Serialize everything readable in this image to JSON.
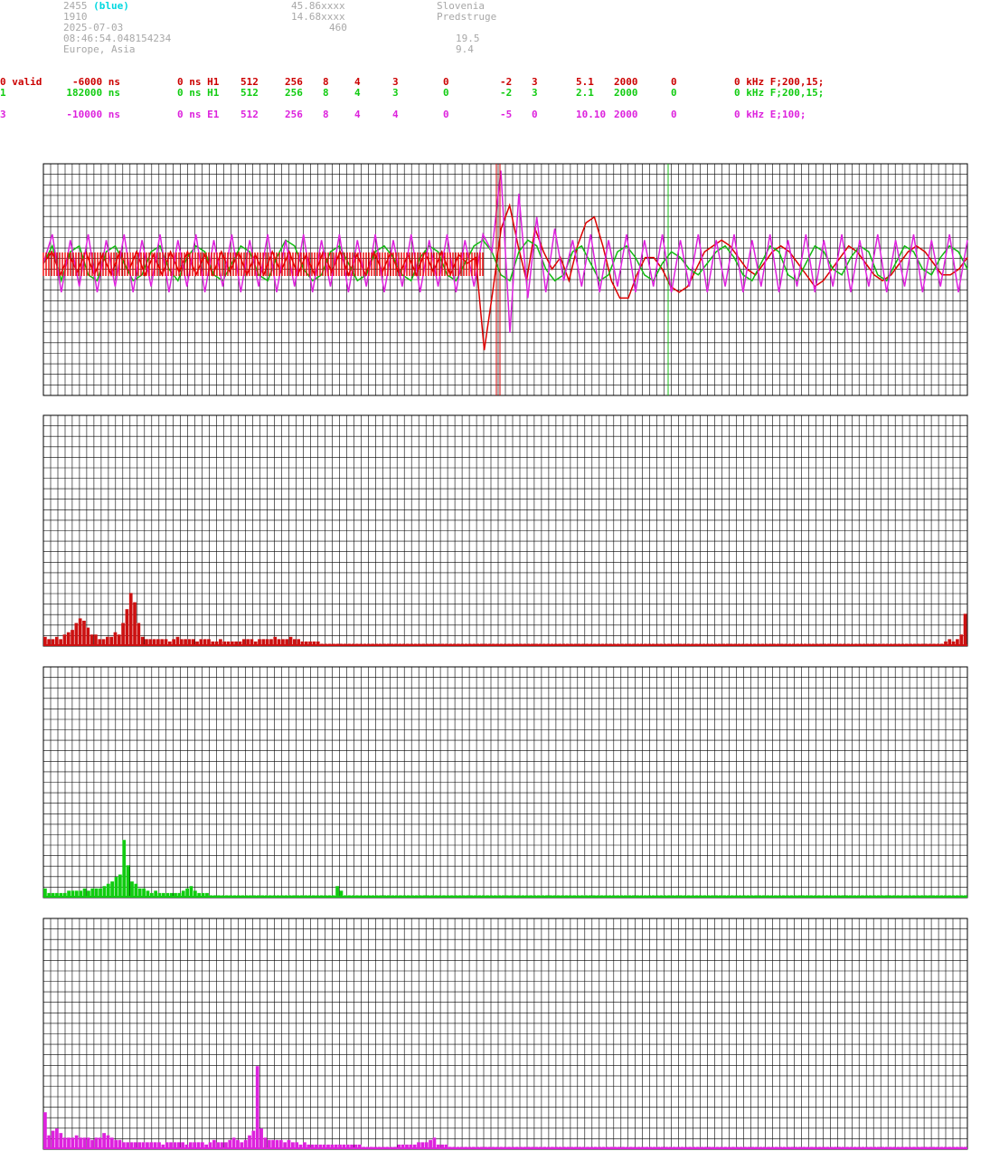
{
  "header": {
    "station_id": "2455",
    "station_tag": "(blue)",
    "line2": "1910",
    "date": "2025-07-03",
    "time": "08:46:54.048154234",
    "region": "Europe, Asia",
    "lat": "45.86xxxx",
    "lon": "14.68xxxx",
    "alt": "460",
    "country": "Slovenia",
    "place": "Predstruge",
    "v1": "19.5",
    "v2": "9.4"
  },
  "channels": [
    {
      "c1": "0 valid",
      "c2": "-6000 ns",
      "c3": "0 ns H1",
      "c4": "512",
      "c5": "256",
      "c6": "8",
      "c7": "4",
      "c8": "3",
      "c9": "0",
      "c10": "-2",
      "c11": "3",
      "c12": "5.1",
      "c13": "2000",
      "c14": "0",
      "c15": "0 kHz F;200,15;"
    },
    {
      "c1": "1",
      "c2": "182000 ns",
      "c3": "0 ns H1",
      "c4": "512",
      "c5": "256",
      "c6": "8",
      "c7": "4",
      "c8": "3",
      "c9": "0",
      "c10": "-2",
      "c11": "3",
      "c12": "2.1",
      "c13": "2000",
      "c14": "0",
      "c15": "0 kHz F;200,15;"
    },
    {
      "c1": "3",
      "c2": "-10000 ns",
      "c3": "0 ns E1",
      "c4": "512",
      "c5": "256",
      "c6": "8",
      "c7": "4",
      "c8": "4",
      "c9": "0",
      "c10": "-5",
      "c11": "0",
      "c12": "10.10",
      "c13": "2000",
      "c14": "0",
      "c15": "0 kHz E;100;"
    }
  ],
  "colors": {
    "red": "#cc0000",
    "green": "#11cc11",
    "magenta": "#dd22dd",
    "grid": "#000000"
  },
  "chart_data": [
    {
      "type": "line",
      "series": [
        {
          "color": "#dd0000",
          "values": [
            0,
            0.2,
            -0.2,
            0.15,
            -0.15,
            0.2,
            -0.2,
            0.15,
            -0.2,
            0.2,
            -0.15,
            0.2,
            -0.2,
            0.15,
            -0.2,
            0.2,
            -0.15,
            0.2,
            -0.2,
            0.15,
            -0.2,
            0.2,
            -0.15,
            0.2,
            -0.2,
            0.15,
            -0.2,
            0.2,
            -0.15,
            0.2,
            -0.2,
            0.15,
            -0.2,
            0.2,
            -0.15,
            0.2,
            -0.2,
            0.15,
            -0.2,
            0.2,
            -0.15,
            0.2,
            -0.2,
            0.15,
            -0.2,
            0.2,
            -0.15,
            0.2,
            -0.2,
            0.15,
            0,
            0.1,
            -1.5,
            -0.5,
            0.6,
            1.0,
            0.3,
            -0.3,
            0.6,
            0.2,
            -0.1,
            0.1,
            -0.3,
            0.3,
            0.7,
            0.8,
            0.3,
            -0.3,
            -0.6,
            -0.6,
            -0.2,
            0.1,
            0.1,
            -0.1,
            -0.4,
            -0.5,
            -0.4,
            -0.1,
            0.2,
            0.3,
            0.4,
            0.3,
            0.1,
            -0.1,
            -0.2,
            0,
            0.2,
            0.3,
            0.2,
            0,
            -0.2,
            -0.4,
            -0.3,
            -0.1,
            0.1,
            0.3,
            0.2,
            0,
            -0.2,
            -0.3,
            -0.2,
            0,
            0.2,
            0.3,
            0.2,
            0,
            -0.2,
            -0.2,
            -0.1,
            0.1
          ]
        },
        {
          "color": "#11bb11",
          "values": [
            0,
            0.3,
            -0.3,
            0.2,
            0.3,
            -0.2,
            -0.3,
            0.2,
            0.3,
            0,
            -0.3,
            -0.2,
            0.2,
            0.3,
            -0.1,
            -0.3,
            0.1,
            0.3,
            0.2,
            -0.2,
            -0.3,
            0,
            0.3,
            0.2,
            -0.2,
            -0.3,
            0.1,
            0.4,
            0.3,
            -0.1,
            -0.3,
            -0.2,
            0.2,
            0.3,
            0,
            -0.3,
            -0.2,
            0.2,
            0.3,
            0.1,
            -0.2,
            -0.3,
            0.1,
            0.3,
            0.2,
            -0.2,
            -0.3,
            0,
            0.3,
            0.4,
            0.2,
            -0.2,
            -0.3,
            0.2,
            0.4,
            0.3,
            -0.1,
            -0.3,
            -0.2,
            0.2,
            0.3,
            0,
            -0.3,
            -0.2,
            0.2,
            0.3,
            0.1,
            -0.2,
            -0.3,
            0,
            0.2,
            0.1,
            -0.1,
            -0.2,
            0,
            0.2,
            0.3,
            0.1,
            -0.2,
            -0.3,
            0,
            0.3,
            0.2,
            -0.2,
            -0.3,
            0,
            0.3,
            0.2,
            -0.1,
            -0.2,
            0.1,
            0.3,
            0.2,
            -0.2,
            -0.3,
            0,
            0.3,
            0.2,
            -0.1,
            -0.2,
            0.1,
            0.3,
            0.2,
            -0.1
          ]
        },
        {
          "color": "#dd22dd",
          "values": [
            0,
            0.5,
            -0.5,
            0.4,
            -0.4,
            0.5,
            -0.5,
            0.4,
            -0.4,
            0.5,
            -0.5,
            0.4,
            -0.4,
            0.5,
            -0.5,
            0.4,
            -0.4,
            0.5,
            -0.5,
            0.4,
            -0.4,
            0.5,
            -0.5,
            0.4,
            -0.4,
            0.5,
            -0.5,
            0.4,
            -0.4,
            0.5,
            -0.5,
            0.4,
            -0.4,
            0.5,
            -0.5,
            0.4,
            -0.4,
            0.5,
            -0.5,
            0.4,
            -0.4,
            0.5,
            -0.5,
            0.4,
            -0.4,
            0.5,
            -0.5,
            0.4,
            -0.4,
            0.5,
            0.2,
            1.6,
            -1.2,
            1.2,
            -0.6,
            0.8,
            -0.5,
            0.6,
            -0.3,
            0.4,
            -0.4,
            0.5,
            -0.5,
            0.4,
            -0.4,
            0.5,
            -0.5,
            0.4,
            -0.4,
            0.5,
            -0.5,
            0.4,
            -0.4,
            0.5,
            -0.5,
            0.4,
            -0.4,
            0.5,
            -0.5,
            0.4,
            -0.4,
            0.5,
            -0.5,
            0.4,
            -0.4,
            0.5,
            -0.5,
            0.4,
            -0.4,
            0.5,
            -0.5,
            0.4,
            -0.4,
            0.5,
            -0.5,
            0.4,
            -0.4,
            0.5,
            -0.5,
            0.4,
            -0.4,
            0.5,
            -0.5,
            0.4
          ]
        }
      ],
      "ylim": [
        -2,
        2
      ]
    },
    {
      "type": "bar",
      "color": "#cc1111",
      "values": [
        4,
        3,
        3,
        4,
        3,
        5,
        6,
        7,
        10,
        12,
        11,
        8,
        5,
        5,
        3,
        3,
        4,
        4,
        6,
        5,
        10,
        16,
        23,
        19,
        10,
        4,
        3,
        3,
        3,
        3,
        3,
        3,
        2,
        3,
        4,
        3,
        3,
        3,
        3,
        2,
        3,
        3,
        3,
        2,
        2,
        3,
        2,
        2,
        2,
        2,
        2,
        3,
        3,
        3,
        2,
        3,
        3,
        3,
        3,
        4,
        3,
        3,
        3,
        4,
        3,
        3,
        2,
        2,
        2,
        2,
        2,
        1,
        1,
        1,
        1,
        1,
        1,
        1,
        1,
        1,
        1,
        1,
        1,
        1,
        1,
        1,
        1,
        1,
        1,
        1,
        1,
        1,
        1,
        1,
        1,
        1,
        1,
        1,
        1,
        1,
        1,
        1,
        1,
        1,
        1,
        1,
        1,
        1,
        1,
        1,
        1,
        1,
        1,
        1,
        1,
        1,
        1,
        1,
        1,
        1,
        1,
        1,
        1,
        1,
        1,
        1,
        1,
        1,
        1,
        1,
        1,
        1,
        1,
        1,
        1,
        1,
        1,
        1,
        1,
        1,
        1,
        1,
        1,
        1,
        1,
        1,
        1,
        1,
        1,
        1,
        1,
        1,
        1,
        1,
        1,
        1,
        1,
        1,
        1,
        1,
        1,
        1,
        1,
        1,
        1,
        1,
        1,
        1,
        1,
        1,
        1,
        1,
        1,
        1,
        1,
        1,
        1,
        1,
        1,
        1,
        1,
        1,
        1,
        1,
        1,
        1,
        1,
        1,
        1,
        1,
        1,
        1,
        1,
        1,
        1,
        1,
        1,
        1,
        1,
        1,
        1,
        1,
        1,
        1,
        1,
        1,
        1,
        1,
        1,
        1,
        1,
        1,
        1,
        1,
        1,
        1,
        1,
        1,
        1,
        1,
        1,
        1,
        1,
        1,
        1,
        1,
        1,
        1,
        1,
        1,
        1,
        2,
        3,
        2,
        3,
        5,
        14
      ],
      "ylim": [
        0,
        100
      ]
    },
    {
      "type": "bar",
      "color": "#11cc11",
      "values": [
        4,
        2,
        2,
        2,
        2,
        2,
        3,
        3,
        3,
        3,
        4,
        3,
        4,
        4,
        4,
        5,
        6,
        7,
        9,
        10,
        25,
        14,
        7,
        6,
        4,
        4,
        3,
        2,
        3,
        2,
        2,
        2,
        2,
        2,
        2,
        3,
        4,
        5,
        3,
        2,
        2,
        2,
        1,
        1,
        1,
        1,
        1,
        1,
        1,
        1,
        1,
        1,
        1,
        1,
        1,
        1,
        1,
        1,
        1,
        1,
        1,
        1,
        1,
        1,
        1,
        1,
        1,
        1,
        1,
        1,
        1,
        1,
        1,
        1,
        5,
        3,
        1,
        1,
        1,
        1,
        1,
        1,
        1,
        1,
        1,
        1,
        1,
        1,
        1,
        1,
        1,
        1,
        1,
        1,
        1,
        1,
        1,
        1,
        1,
        1,
        1,
        1,
        1,
        1,
        1,
        1,
        1,
        1,
        1,
        1,
        1,
        1,
        1,
        1,
        1,
        1,
        1,
        1,
        1,
        1,
        1,
        1,
        1,
        1,
        1,
        1,
        1,
        1,
        1,
        1,
        1,
        1,
        1,
        1,
        1,
        1,
        1,
        1,
        1,
        1,
        1,
        1,
        1,
        1,
        1,
        1,
        1,
        1,
        1,
        1,
        1,
        1,
        1,
        1,
        1,
        1,
        1,
        1,
        1,
        1,
        1,
        1,
        1,
        1,
        1,
        1,
        1,
        1,
        1,
        1,
        1,
        1,
        1,
        1,
        1,
        1,
        1,
        1,
        1,
        1,
        1,
        1,
        1,
        1,
        1,
        1,
        1,
        1,
        1,
        1,
        1,
        1,
        1,
        1,
        1,
        1,
        1,
        1,
        1,
        1,
        1,
        1,
        1,
        1,
        1,
        1,
        1,
        1,
        1,
        1,
        1,
        1,
        1,
        1,
        1,
        1,
        1,
        1,
        1,
        1,
        1,
        1,
        1,
        1,
        1,
        1,
        1,
        1,
        1,
        1,
        1,
        1,
        1,
        1
      ],
      "ylim": [
        0,
        100
      ]
    },
    {
      "type": "bar",
      "color": "#dd22dd",
      "values": [
        16,
        6,
        8,
        9,
        7,
        5,
        5,
        5,
        6,
        5,
        5,
        5,
        4,
        5,
        5,
        7,
        6,
        5,
        4,
        4,
        3,
        3,
        3,
        3,
        3,
        3,
        3,
        3,
        3,
        3,
        2,
        3,
        3,
        3,
        3,
        3,
        2,
        3,
        3,
        3,
        3,
        2,
        3,
        4,
        3,
        3,
        3,
        4,
        5,
        4,
        3,
        4,
        6,
        8,
        36,
        9,
        5,
        4,
        4,
        4,
        4,
        3,
        4,
        3,
        3,
        2,
        3,
        2,
        2,
        2,
        2,
        2,
        2,
        2,
        2,
        2,
        2,
        2,
        2,
        2,
        2,
        1,
        1,
        1,
        1,
        1,
        1,
        1,
        1,
        1,
        2,
        2,
        2,
        2,
        2,
        3,
        3,
        3,
        4,
        5,
        2,
        2,
        2,
        1,
        1,
        1,
        1,
        1,
        1,
        1,
        1,
        1,
        1,
        1,
        1,
        1,
        1,
        1,
        1,
        1,
        1,
        1,
        1,
        1,
        1,
        1,
        1,
        1,
        1,
        1,
        1,
        1,
        1,
        1,
        1,
        1,
        1,
        1,
        1,
        1,
        1,
        1,
        1,
        1,
        1,
        1,
        1,
        1,
        1,
        1,
        1,
        1,
        1,
        1,
        1,
        1,
        1,
        1,
        1,
        1,
        1,
        1,
        1,
        1,
        1,
        1,
        1,
        1,
        1,
        1,
        1,
        1,
        1,
        1,
        1,
        1,
        1,
        1,
        1,
        1,
        1,
        1,
        1,
        1,
        1,
        1,
        1,
        1,
        1,
        1,
        1,
        1,
        1,
        1,
        1,
        1,
        1,
        1,
        1,
        1,
        1,
        1,
        1,
        1,
        1,
        1,
        1,
        1,
        1,
        1,
        1,
        1,
        1,
        1,
        1,
        1,
        1,
        1,
        1,
        1,
        1,
        1,
        1,
        1,
        1,
        1,
        1,
        1,
        1,
        1,
        1,
        1,
        1,
        1,
        1
      ],
      "ylim": [
        0,
        100
      ]
    }
  ]
}
